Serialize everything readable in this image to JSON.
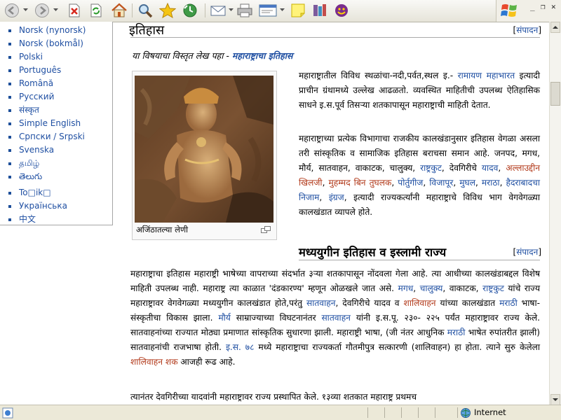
{
  "toolbar": {
    "icons": [
      "back-icon",
      "forward-icon",
      "stop-icon",
      "refresh-icon",
      "home-icon",
      "search-icon",
      "favorites-icon",
      "history-icon",
      "mail-icon",
      "print-icon",
      "edit-icon",
      "notes-icon",
      "research-icon",
      "messenger-icon"
    ],
    "window_controls": {
      "minimize": "_",
      "restore": "❐",
      "close": "✕"
    }
  },
  "languages": [
    "Norsk (nynorsk)",
    "Norsk (bokmål)",
    "Polski",
    "Português",
    "Română",
    "Русский",
    "संस्कृत",
    "Simple English",
    "Српски / Srpski",
    "Svenska",
    "தமிழ்",
    "తెలుగు",
    "To□ik□",
    "Українська",
    "中文"
  ],
  "history_section": {
    "title": "इतिहास",
    "edit_label": "संपादन",
    "note_prefix": "या विषयाचा विस्तृत लेख पहा - ",
    "note_link": "महाराष्ट्राचा इतिहास",
    "thumb_caption": "अजिंठातल्या लेणी",
    "p1": {
      "t1": "महाराष्ट्रातील विविध स्थळांचा-नदी,पर्वत,स्थल इ.- ",
      "ramayana": "रामायण",
      "mahabharata": "महाभारत",
      "t2": " इत्यादी प्राचीन ग्रंथामध्ये उल्लेख आढळतो. व्यवस्थित माहितीची उपलब्ध ऐतिहासिक साधने इ.स.पूर्व तिसऱ्या शतकापासून महाराष्ट्राची माहिती देतात."
    },
    "p2": {
      "t1": "महाराष्ट्राच्या प्रत्येक विभागाचा राजकीय कालखंडानुसार इतिहास वेगळा असला तरी सांस्कृतिक व सामाजिक इतिहास बराचसा समान आहे. जनपद, मगध, मौर्य, सातवाहन, वाकाटक, चालुक्य, ",
      "rashtrakuta": "राष्ट्रकुट",
      "t2": ", देवगिरीचे ",
      "yadav": "यादव",
      "alauddin": "अल्लाउद्दीन खिलजी",
      "tughlaq": "मुहम्मद बिन तुघलक",
      "portuguese": "पोर्तुगीज",
      "vijapur": "विजापूर",
      "mughal": "मुघल",
      "maratha": "मराठा",
      "nizam": "हैदराबादचा निजाम",
      "english": "इंग्रज",
      "t3": ", इत्यादी राज्यकर्त्यांनी महाराष्ट्राचे विविध भाग वेगवेगळ्या कालखंडात व्यापले होते."
    }
  },
  "medieval_section": {
    "title": "मध्ययुगीन इतिहास व इस्लामी राज्य",
    "edit_label": "संपादन",
    "p1": {
      "t1": "महाराष्ट्राचा इतिहास महाराष्ट्री भाषेच्या वापराच्या संदर्भात ३ऱ्या शतकापासून नोंदवला गेला आहे. त्या आधीच्या कालखंडाबद्दल विशेष माहिती उपलब्ध नाही. महाराष्ट्र त्या काळात 'दंडकारण्य' म्हणून ओळखले जात असे. ",
      "magadh": "मगध",
      "chalukya": "चालुक्य",
      "t2": ", वाकाटक, ",
      "rashtrakuta": "राष्ट्रकुट",
      "t3": " यांचे राज्य महाराष्ट्रावर वेगवेगळ्या मध्ययुगीन कालखंडात होते,परंतु ",
      "satavahan": "सातवाहन",
      "t4": ", देवगिरीचे यादव व ",
      "shalivahan": "शालिवाहन",
      "t5": " यांच्या कालखंडात ",
      "marathi": "मराठी",
      "t6": " भाषा-संस्कृतीचा विकास झाला. ",
      "maurya": "मौर्य",
      "t7": " साम्राज्याच्या विघटनानंतर ",
      "satavahan2": "सातवाहन",
      "t8": " यांनी इ.स.पू. २३०- २२५ पर्यंत महाराष्ट्रावर राज्य केले. सातवाहनांच्या राज्यात मोठ्या प्रमाणात सांस्कृतिक सुधारणा झाली. महाराष्ट्री भाषा, (जी नंतर आधुनिक ",
      "marathi2": "मराठी",
      "t9": " भाषेत रुपांतरीत झाली) सातवाहनांची राजभाषा होती. ",
      "year78": "इ.स. ७८",
      "t10": " मध्ये महाराष्ट्राचा राज्यकर्ता गौतमीपुत्र सत्कारणी (शालिवाहन) हा होता. त्याने सुरु केलेला ",
      "shaka": "शालिवाहन शक",
      "t11": " आजही रूढ आहे."
    },
    "p2": "त्यानंतर देवगिरीच्या यादवांनी महाराष्ट्रावर राज्य प्रस्थापित केले. १३व्या शतकात महाराष्ट्र प्रथमच"
  },
  "statusbar": {
    "zone": "Internet"
  },
  "colors": {
    "link": "#1f4fa2",
    "redlink": "#b23a1b",
    "chrome": "#ece9d8"
  }
}
